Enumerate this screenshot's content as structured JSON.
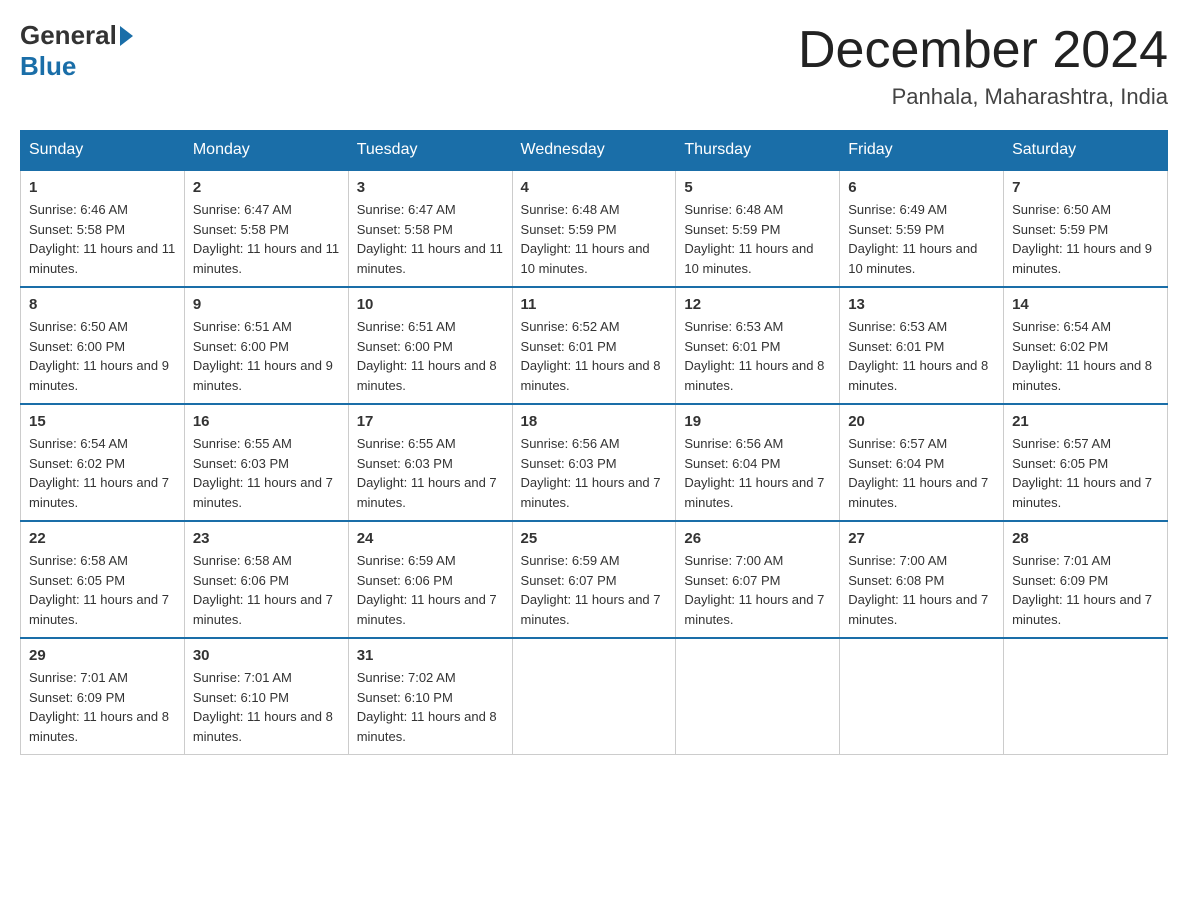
{
  "logo": {
    "general": "General",
    "blue": "Blue",
    "triangle": "▶"
  },
  "title": "December 2024",
  "subtitle": "Panhala, Maharashtra, India",
  "days_of_week": [
    "Sunday",
    "Monday",
    "Tuesday",
    "Wednesday",
    "Thursday",
    "Friday",
    "Saturday"
  ],
  "weeks": [
    [
      {
        "day": "1",
        "sunrise": "6:46 AM",
        "sunset": "5:58 PM",
        "daylight": "11 hours and 11 minutes."
      },
      {
        "day": "2",
        "sunrise": "6:47 AM",
        "sunset": "5:58 PM",
        "daylight": "11 hours and 11 minutes."
      },
      {
        "day": "3",
        "sunrise": "6:47 AM",
        "sunset": "5:58 PM",
        "daylight": "11 hours and 11 minutes."
      },
      {
        "day": "4",
        "sunrise": "6:48 AM",
        "sunset": "5:59 PM",
        "daylight": "11 hours and 10 minutes."
      },
      {
        "day": "5",
        "sunrise": "6:48 AM",
        "sunset": "5:59 PM",
        "daylight": "11 hours and 10 minutes."
      },
      {
        "day": "6",
        "sunrise": "6:49 AM",
        "sunset": "5:59 PM",
        "daylight": "11 hours and 10 minutes."
      },
      {
        "day": "7",
        "sunrise": "6:50 AM",
        "sunset": "5:59 PM",
        "daylight": "11 hours and 9 minutes."
      }
    ],
    [
      {
        "day": "8",
        "sunrise": "6:50 AM",
        "sunset": "6:00 PM",
        "daylight": "11 hours and 9 minutes."
      },
      {
        "day": "9",
        "sunrise": "6:51 AM",
        "sunset": "6:00 PM",
        "daylight": "11 hours and 9 minutes."
      },
      {
        "day": "10",
        "sunrise": "6:51 AM",
        "sunset": "6:00 PM",
        "daylight": "11 hours and 8 minutes."
      },
      {
        "day": "11",
        "sunrise": "6:52 AM",
        "sunset": "6:01 PM",
        "daylight": "11 hours and 8 minutes."
      },
      {
        "day": "12",
        "sunrise": "6:53 AM",
        "sunset": "6:01 PM",
        "daylight": "11 hours and 8 minutes."
      },
      {
        "day": "13",
        "sunrise": "6:53 AM",
        "sunset": "6:01 PM",
        "daylight": "11 hours and 8 minutes."
      },
      {
        "day": "14",
        "sunrise": "6:54 AM",
        "sunset": "6:02 PM",
        "daylight": "11 hours and 8 minutes."
      }
    ],
    [
      {
        "day": "15",
        "sunrise": "6:54 AM",
        "sunset": "6:02 PM",
        "daylight": "11 hours and 7 minutes."
      },
      {
        "day": "16",
        "sunrise": "6:55 AM",
        "sunset": "6:03 PM",
        "daylight": "11 hours and 7 minutes."
      },
      {
        "day": "17",
        "sunrise": "6:55 AM",
        "sunset": "6:03 PM",
        "daylight": "11 hours and 7 minutes."
      },
      {
        "day": "18",
        "sunrise": "6:56 AM",
        "sunset": "6:03 PM",
        "daylight": "11 hours and 7 minutes."
      },
      {
        "day": "19",
        "sunrise": "6:56 AM",
        "sunset": "6:04 PM",
        "daylight": "11 hours and 7 minutes."
      },
      {
        "day": "20",
        "sunrise": "6:57 AM",
        "sunset": "6:04 PM",
        "daylight": "11 hours and 7 minutes."
      },
      {
        "day": "21",
        "sunrise": "6:57 AM",
        "sunset": "6:05 PM",
        "daylight": "11 hours and 7 minutes."
      }
    ],
    [
      {
        "day": "22",
        "sunrise": "6:58 AM",
        "sunset": "6:05 PM",
        "daylight": "11 hours and 7 minutes."
      },
      {
        "day": "23",
        "sunrise": "6:58 AM",
        "sunset": "6:06 PM",
        "daylight": "11 hours and 7 minutes."
      },
      {
        "day": "24",
        "sunrise": "6:59 AM",
        "sunset": "6:06 PM",
        "daylight": "11 hours and 7 minutes."
      },
      {
        "day": "25",
        "sunrise": "6:59 AM",
        "sunset": "6:07 PM",
        "daylight": "11 hours and 7 minutes."
      },
      {
        "day": "26",
        "sunrise": "7:00 AM",
        "sunset": "6:07 PM",
        "daylight": "11 hours and 7 minutes."
      },
      {
        "day": "27",
        "sunrise": "7:00 AM",
        "sunset": "6:08 PM",
        "daylight": "11 hours and 7 minutes."
      },
      {
        "day": "28",
        "sunrise": "7:01 AM",
        "sunset": "6:09 PM",
        "daylight": "11 hours and 7 minutes."
      }
    ],
    [
      {
        "day": "29",
        "sunrise": "7:01 AM",
        "sunset": "6:09 PM",
        "daylight": "11 hours and 8 minutes."
      },
      {
        "day": "30",
        "sunrise": "7:01 AM",
        "sunset": "6:10 PM",
        "daylight": "11 hours and 8 minutes."
      },
      {
        "day": "31",
        "sunrise": "7:02 AM",
        "sunset": "6:10 PM",
        "daylight": "11 hours and 8 minutes."
      },
      null,
      null,
      null,
      null
    ]
  ]
}
